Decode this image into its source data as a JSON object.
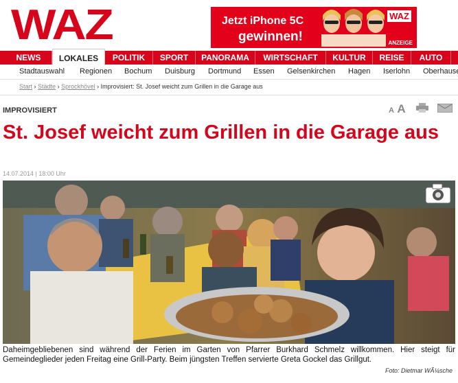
{
  "brand": {
    "logo": "WAZ"
  },
  "ad": {
    "line1": "Jetzt iPhone 5C",
    "line2": "gewinnen!",
    "brand": "WAZ",
    "tag": "ANZEIGE"
  },
  "nav": [
    "NEWS",
    "LOKALES",
    "POLITIK",
    "SPORT",
    "PANORAMA",
    "WIRTSCHAFT",
    "KULTUR",
    "REISE",
    "AUTO"
  ],
  "nav_active": "LOKALES",
  "subnav": [
    "Stadtauswahl",
    "Regionen",
    "Bochum",
    "Duisburg",
    "Dortmund",
    "Essen",
    "Gelsenkirchen",
    "Hagen",
    "Iserlohn",
    "Oberhausen"
  ],
  "breadcrumb": {
    "links": [
      "Start",
      "Städte",
      "Sprockhövel"
    ],
    "separator": "›",
    "current": "Improvisiert: St. Josef weicht zum Grillen in die Garage aus"
  },
  "article": {
    "kicker": "IMPROVISIERT",
    "title": "St. Josef weicht zum Grillen in die Garage aus",
    "date": "14.07.2014 | 18:00 Uhr",
    "caption": "Daheimgebliebenen sind während der Ferien im Garten von Pfarrer Burkhard Schmelz willkommen. Hier steigt für Gemeindeglieder jeden Freitag eine Grill-Party. Beim jüngsten Treffen servierte Greta Gockel das Grillgut.",
    "credit": "Foto: Dietmar WÃ¼sche"
  },
  "tools": {
    "font_small": "A",
    "font_large": "A"
  },
  "icons": [
    "text-size-icon",
    "print-icon",
    "mail-icon",
    "camera-icon"
  ],
  "colors": {
    "brand_red": "#d6051c",
    "ad_red": "#e2001a"
  }
}
